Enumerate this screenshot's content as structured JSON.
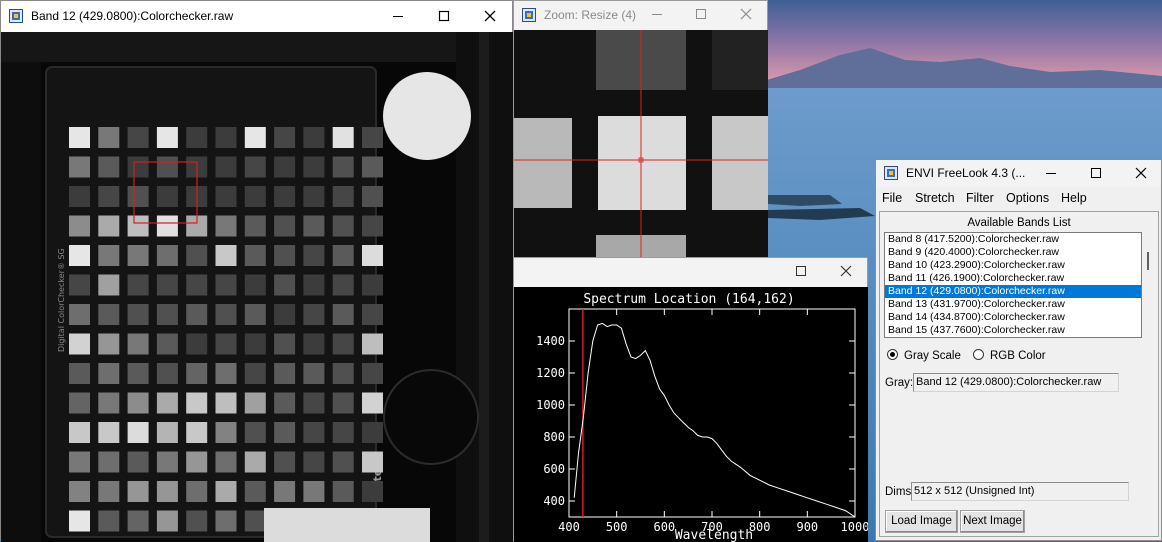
{
  "desktop": {
    "sky_colors": [
      "#3e5f93",
      "#7d6fa0",
      "#e89aa8"
    ],
    "water_color": "#4c86b9"
  },
  "band_window": {
    "title": "Band 12 (429.0800):Colorchecker.raw",
    "chart_brand": "Digital ColorChecker® SG",
    "maker_logo": "x·rite"
  },
  "zoom_window": {
    "title": "Zoom: Resize (4)"
  },
  "plot_window": {
    "title": "Spectrum Location (164,162)",
    "xlabel": "Wavelength",
    "x_ticks": [
      "400",
      "500",
      "600",
      "700",
      "800",
      "900",
      "1000"
    ],
    "y_ticks": [
      "400",
      "600",
      "800",
      "1000",
      "1200",
      "1400"
    ]
  },
  "envi_window": {
    "title": "ENVI FreeLook 4.3 (...",
    "menus": [
      "File",
      "Stretch",
      "Filter",
      "Options",
      "Help"
    ],
    "bands_header": "Available Bands List",
    "bands": [
      "Band 8 (417.5200):Colorchecker.raw",
      "Band 9 (420.4000):Colorchecker.raw",
      "Band 10 (423.2900):Colorchecker.raw",
      "Band 11 (426.1900):Colorchecker.raw",
      "Band 12 (429.0800):Colorchecker.raw",
      "Band 13 (431.9700):Colorchecker.raw",
      "Band 14 (434.8700):Colorchecker.raw",
      "Band 15 (437.7600):Colorchecker.raw"
    ],
    "selected_band_index": 4,
    "radio_gray": "Gray Scale",
    "radio_rgb": "RGB Color",
    "gray_label": "Gray:",
    "gray_value": "Band 12 (429.0800):Colorchecker.raw",
    "dims_label": "Dims",
    "dims_value": "512 x 512 (Unsigned Int)",
    "load_button": "Load Image",
    "next_button": "Next Image",
    "selection_color": "#0078d7"
  },
  "chart_data": {
    "type": "line",
    "title": "Spectrum Location (164,162)",
    "xlabel": "Wavelength",
    "ylabel": "",
    "xlim": [
      400,
      1000
    ],
    "ylim": [
      300,
      1600
    ],
    "marker_line_x": 429.08,
    "series": [
      {
        "x": [
          411,
          420,
          430,
          440,
          450,
          460,
          470,
          480,
          490,
          500,
          510,
          520,
          530,
          540,
          550,
          560,
          570,
          580,
          590,
          600,
          610,
          620,
          630,
          640,
          650,
          660,
          670,
          680,
          690,
          700,
          710,
          720,
          730,
          740,
          750,
          760,
          780,
          800,
          820,
          840,
          860,
          880,
          900,
          920,
          940,
          960,
          980,
          1000
        ],
        "y": [
          420,
          700,
          920,
          1200,
          1400,
          1500,
          1510,
          1490,
          1500,
          1500,
          1480,
          1380,
          1300,
          1290,
          1310,
          1340,
          1280,
          1180,
          1100,
          1060,
          1000,
          950,
          920,
          890,
          860,
          840,
          810,
          800,
          800,
          790,
          760,
          720,
          680,
          650,
          630,
          610,
          560,
          530,
          500,
          480,
          460,
          440,
          420,
          400,
          380,
          360,
          340,
          300
        ]
      }
    ]
  }
}
